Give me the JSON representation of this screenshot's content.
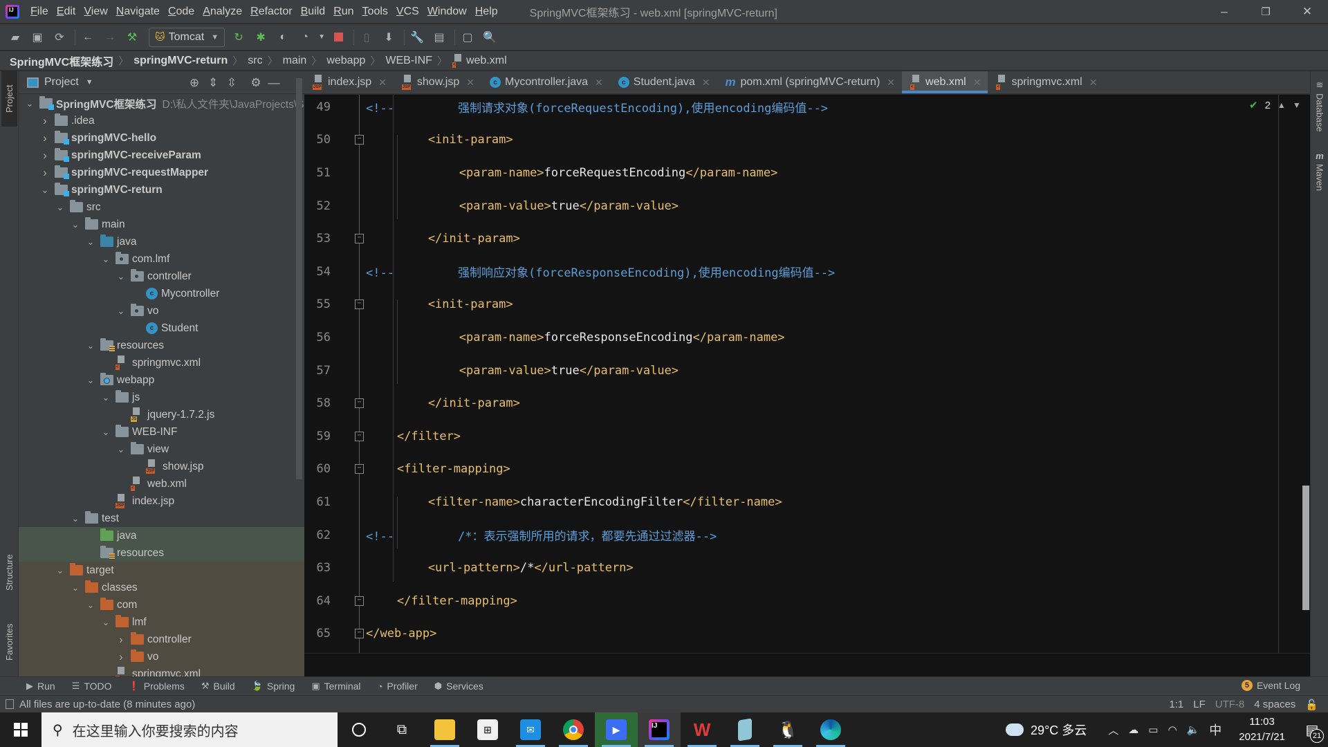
{
  "window": {
    "title": "SpringMVC框架练习 - web.xml [springMVC-return]",
    "controls": {
      "minimize": "–",
      "restore": "❐",
      "close": "✕"
    }
  },
  "menu": [
    "File",
    "Edit",
    "View",
    "Navigate",
    "Code",
    "Analyze",
    "Refactor",
    "Build",
    "Run",
    "Tools",
    "VCS",
    "Window",
    "Help"
  ],
  "toolbar": {
    "run_config": "Tomcat",
    "icons": [
      "open-icon",
      "save-icon",
      "sync-icon",
      "back-icon",
      "forward-icon",
      "build-hammer-icon",
      "rerun-icon",
      "debug-icon",
      "coverage-icon",
      "profile-icon",
      "stop-icon",
      "device-icon",
      "deploy-icon",
      "settings-wrench-icon",
      "project-structure-icon",
      "terminal-icon",
      "search-icon"
    ]
  },
  "breadcrumb": [
    "SpringMVC框架练习",
    "springMVC-return",
    "src",
    "main",
    "webapp",
    "WEB-INF",
    "web.xml"
  ],
  "left_strip": {
    "project": "Project",
    "structure": "Structure",
    "favorites": "Favorites"
  },
  "right_strip": {
    "database": "Database",
    "maven": "Maven"
  },
  "project_panel": {
    "title": "Project",
    "tree": [
      {
        "label": "SpringMVC框架练习",
        "path": "D:\\私人文件夹\\JavaProjects\\S",
        "depth": 0,
        "expanded": true,
        "icon": "module",
        "bold": true
      },
      {
        "label": ".idea",
        "depth": 1,
        "expanded": false,
        "icon": "folder"
      },
      {
        "label": "springMVC-hello",
        "depth": 1,
        "expanded": false,
        "icon": "module",
        "bold": true
      },
      {
        "label": "springMVC-receiveParam",
        "depth": 1,
        "expanded": false,
        "icon": "module",
        "bold": true
      },
      {
        "label": "springMVC-requestMapper",
        "depth": 1,
        "expanded": false,
        "icon": "module",
        "bold": true
      },
      {
        "label": "springMVC-return",
        "depth": 1,
        "expanded": true,
        "icon": "module",
        "bold": true
      },
      {
        "label": "src",
        "depth": 2,
        "expanded": true,
        "icon": "folder"
      },
      {
        "label": "main",
        "depth": 3,
        "expanded": true,
        "icon": "folder"
      },
      {
        "label": "java",
        "depth": 4,
        "expanded": true,
        "icon": "source-folder"
      },
      {
        "label": "com.lmf",
        "depth": 5,
        "expanded": true,
        "icon": "package"
      },
      {
        "label": "controller",
        "depth": 6,
        "expanded": true,
        "icon": "package"
      },
      {
        "label": "Mycontroller",
        "depth": 7,
        "icon": "class"
      },
      {
        "label": "vo",
        "depth": 6,
        "expanded": true,
        "icon": "package"
      },
      {
        "label": "Student",
        "depth": 7,
        "icon": "class"
      },
      {
        "label": "resources",
        "depth": 4,
        "expanded": true,
        "icon": "resources"
      },
      {
        "label": "springmvc.xml",
        "depth": 5,
        "icon": "xml"
      },
      {
        "label": "webapp",
        "depth": 4,
        "expanded": true,
        "icon": "web"
      },
      {
        "label": "js",
        "depth": 5,
        "expanded": true,
        "icon": "folder"
      },
      {
        "label": "jquery-1.7.2.js",
        "depth": 6,
        "icon": "js"
      },
      {
        "label": "WEB-INF",
        "depth": 5,
        "expanded": true,
        "icon": "folder"
      },
      {
        "label": "view",
        "depth": 6,
        "expanded": true,
        "icon": "folder"
      },
      {
        "label": "show.jsp",
        "depth": 7,
        "icon": "jsp"
      },
      {
        "label": "web.xml",
        "depth": 6,
        "icon": "xml"
      },
      {
        "label": "index.jsp",
        "depth": 5,
        "icon": "jsp"
      },
      {
        "label": "test",
        "depth": 3,
        "expanded": true,
        "icon": "folder"
      },
      {
        "label": "java",
        "depth": 4,
        "icon": "test-folder",
        "bg": "test"
      },
      {
        "label": "resources",
        "depth": 4,
        "icon": "test-resources",
        "bg": "test"
      },
      {
        "label": "target",
        "depth": 2,
        "expanded": true,
        "icon": "excluded",
        "bg": "target"
      },
      {
        "label": "classes",
        "depth": 3,
        "expanded": true,
        "icon": "excluded",
        "bg": "target"
      },
      {
        "label": "com",
        "depth": 4,
        "expanded": true,
        "icon": "excluded",
        "bg": "target"
      },
      {
        "label": "lmf",
        "depth": 5,
        "expanded": true,
        "icon": "excluded",
        "bg": "target"
      },
      {
        "label": "controller",
        "depth": 6,
        "expanded": false,
        "icon": "excluded",
        "bg": "target"
      },
      {
        "label": "vo",
        "depth": 6,
        "expanded": false,
        "icon": "excluded",
        "bg": "target"
      },
      {
        "label": "springmvc.xml",
        "depth": 5,
        "icon": "xml",
        "bg": "target"
      }
    ]
  },
  "tabs": [
    {
      "label": "index.jsp",
      "icon": "jsp",
      "active": false
    },
    {
      "label": "show.jsp",
      "icon": "jsp",
      "active": false
    },
    {
      "label": "Mycontroller.java",
      "icon": "class",
      "active": false
    },
    {
      "label": "Student.java",
      "icon": "class",
      "active": false
    },
    {
      "label": "pom.xml (springMVC-return)",
      "icon": "maven",
      "active": false
    },
    {
      "label": "web.xml",
      "icon": "xml",
      "active": true
    },
    {
      "label": "springmvc.xml",
      "icon": "xml",
      "active": false
    }
  ],
  "editor": {
    "inspection_count": "2",
    "lines": [
      {
        "n": "49",
        "indent": 0,
        "parts": [
          [
            "cmt",
            "<!--         强制请求对象(forceRequestEncoding),使用encoding编码值-->"
          ]
        ]
      },
      {
        "n": "50",
        "indent": 2,
        "fold": "open",
        "parts": [
          [
            "tag",
            "<init-param>"
          ]
        ]
      },
      {
        "n": "51",
        "indent": 3,
        "parts": [
          [
            "tag",
            "<param-name>"
          ],
          [
            "txt",
            "forceRequestEncoding"
          ],
          [
            "tag",
            "</param-name>"
          ]
        ]
      },
      {
        "n": "52",
        "indent": 3,
        "parts": [
          [
            "tag",
            "<param-value>"
          ],
          [
            "txt",
            "true"
          ],
          [
            "tag",
            "</param-value>"
          ]
        ]
      },
      {
        "n": "53",
        "indent": 2,
        "fold": "close",
        "parts": [
          [
            "tag",
            "</init-param>"
          ]
        ]
      },
      {
        "n": "54",
        "indent": 0,
        "parts": [
          [
            "cmt",
            "<!--         强制响应对象(forceResponseEncoding),使用encoding编码值-->"
          ]
        ]
      },
      {
        "n": "55",
        "indent": 2,
        "fold": "open",
        "parts": [
          [
            "tag",
            "<init-param>"
          ]
        ]
      },
      {
        "n": "56",
        "indent": 3,
        "parts": [
          [
            "tag",
            "<param-name>"
          ],
          [
            "txt",
            "forceResponseEncoding"
          ],
          [
            "tag",
            "</param-name>"
          ]
        ]
      },
      {
        "n": "57",
        "indent": 3,
        "parts": [
          [
            "tag",
            "<param-value>"
          ],
          [
            "txt",
            "true"
          ],
          [
            "tag",
            "</param-value>"
          ]
        ]
      },
      {
        "n": "58",
        "indent": 2,
        "fold": "close",
        "parts": [
          [
            "tag",
            "</init-param>"
          ]
        ]
      },
      {
        "n": "59",
        "indent": 1,
        "fold": "close",
        "parts": [
          [
            "tag",
            "</filter>"
          ]
        ]
      },
      {
        "n": "60",
        "indent": 1,
        "fold": "open",
        "parts": [
          [
            "tag",
            "<filter-mapping>"
          ]
        ]
      },
      {
        "n": "61",
        "indent": 2,
        "parts": [
          [
            "tag",
            "<filter-name>"
          ],
          [
            "txt",
            "characterEncodingFilter"
          ],
          [
            "tag",
            "</filter-name>"
          ]
        ]
      },
      {
        "n": "62",
        "indent": 0,
        "parts": [
          [
            "cmt",
            "<!--         /*：表示强制所用的请求，都要先通过过滤器-->"
          ]
        ]
      },
      {
        "n": "63",
        "indent": 2,
        "parts": [
          [
            "tag",
            "<url-pattern>"
          ],
          [
            "txt",
            "/*"
          ],
          [
            "tag",
            "</url-pattern>"
          ]
        ]
      },
      {
        "n": "64",
        "indent": 1,
        "fold": "close",
        "parts": [
          [
            "tag",
            "</filter-mapping>"
          ]
        ]
      },
      {
        "n": "65",
        "indent": 0,
        "fold": "close",
        "parts": [
          [
            "tag",
            "</web-app>"
          ]
        ]
      }
    ]
  },
  "toolwindows": [
    {
      "label": "Run",
      "icon": "▶"
    },
    {
      "label": "TODO",
      "icon": "☰"
    },
    {
      "label": "Problems",
      "icon": "❗"
    },
    {
      "label": "Build",
      "icon": "⚒"
    },
    {
      "label": "Spring",
      "icon": "🍃"
    },
    {
      "label": "Terminal",
      "icon": "▣"
    },
    {
      "label": "Profiler",
      "icon": "◔"
    },
    {
      "label": "Services",
      "icon": "⬢"
    }
  ],
  "event_log": {
    "label": "Event Log",
    "count": "5"
  },
  "status": {
    "message": "All files are up-to-date (8 minutes ago)",
    "position": "1:1",
    "line_sep": "LF",
    "encoding": "UTF-8",
    "indent": "4 spaces"
  },
  "taskbar": {
    "search_placeholder": "在这里输入你要搜索的内容",
    "apps": [
      "cortana",
      "task-view",
      "file-explorer",
      "microsoft-store",
      "mail",
      "chrome",
      "video-app",
      "intellij-idea",
      "wps-office",
      "notepad",
      "qq",
      "edge"
    ],
    "weather": "29°C 多云",
    "ime": "中",
    "time": "11:03",
    "date": "2021/7/21",
    "notifications": "21"
  }
}
